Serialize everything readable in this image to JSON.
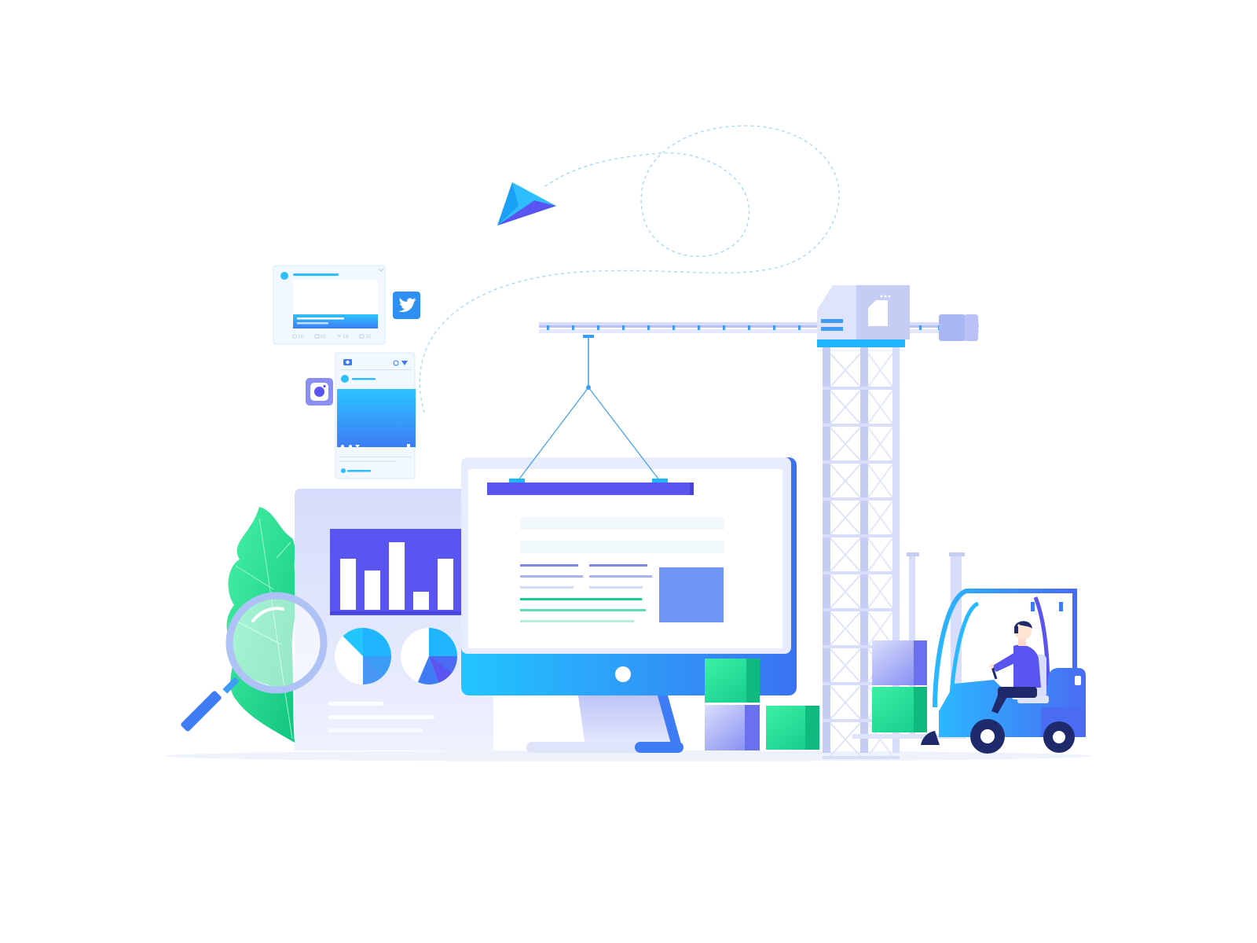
{
  "illustration": {
    "subject": "website-construction",
    "colors": {
      "background": "#ffffff",
      "blue": "#1fb6ff",
      "deep_blue": "#3d7cf5",
      "indigo": "#5a55f0",
      "violet": "#7b6cf6",
      "green": "#18d69a",
      "light_panel": "#e8ecff",
      "pale_lavender": "#c9d1f5",
      "ground": "#eef2fb"
    },
    "tweet_card": {
      "counters": [
        "10",
        "10",
        "10",
        "10"
      ]
    },
    "icons": [
      "paper-plane-icon",
      "twitter-icon",
      "instagram-icon",
      "camera-icon",
      "magnifying-glass-icon",
      "bar-chart-icon",
      "pie-chart-icon",
      "monitor-icon",
      "crane-icon",
      "forklift-icon",
      "worker-icon",
      "leaf-icon",
      "box-icon"
    ],
    "dashboard_bars": [
      0.72,
      0.55,
      0.95,
      0.25,
      0.72
    ]
  }
}
